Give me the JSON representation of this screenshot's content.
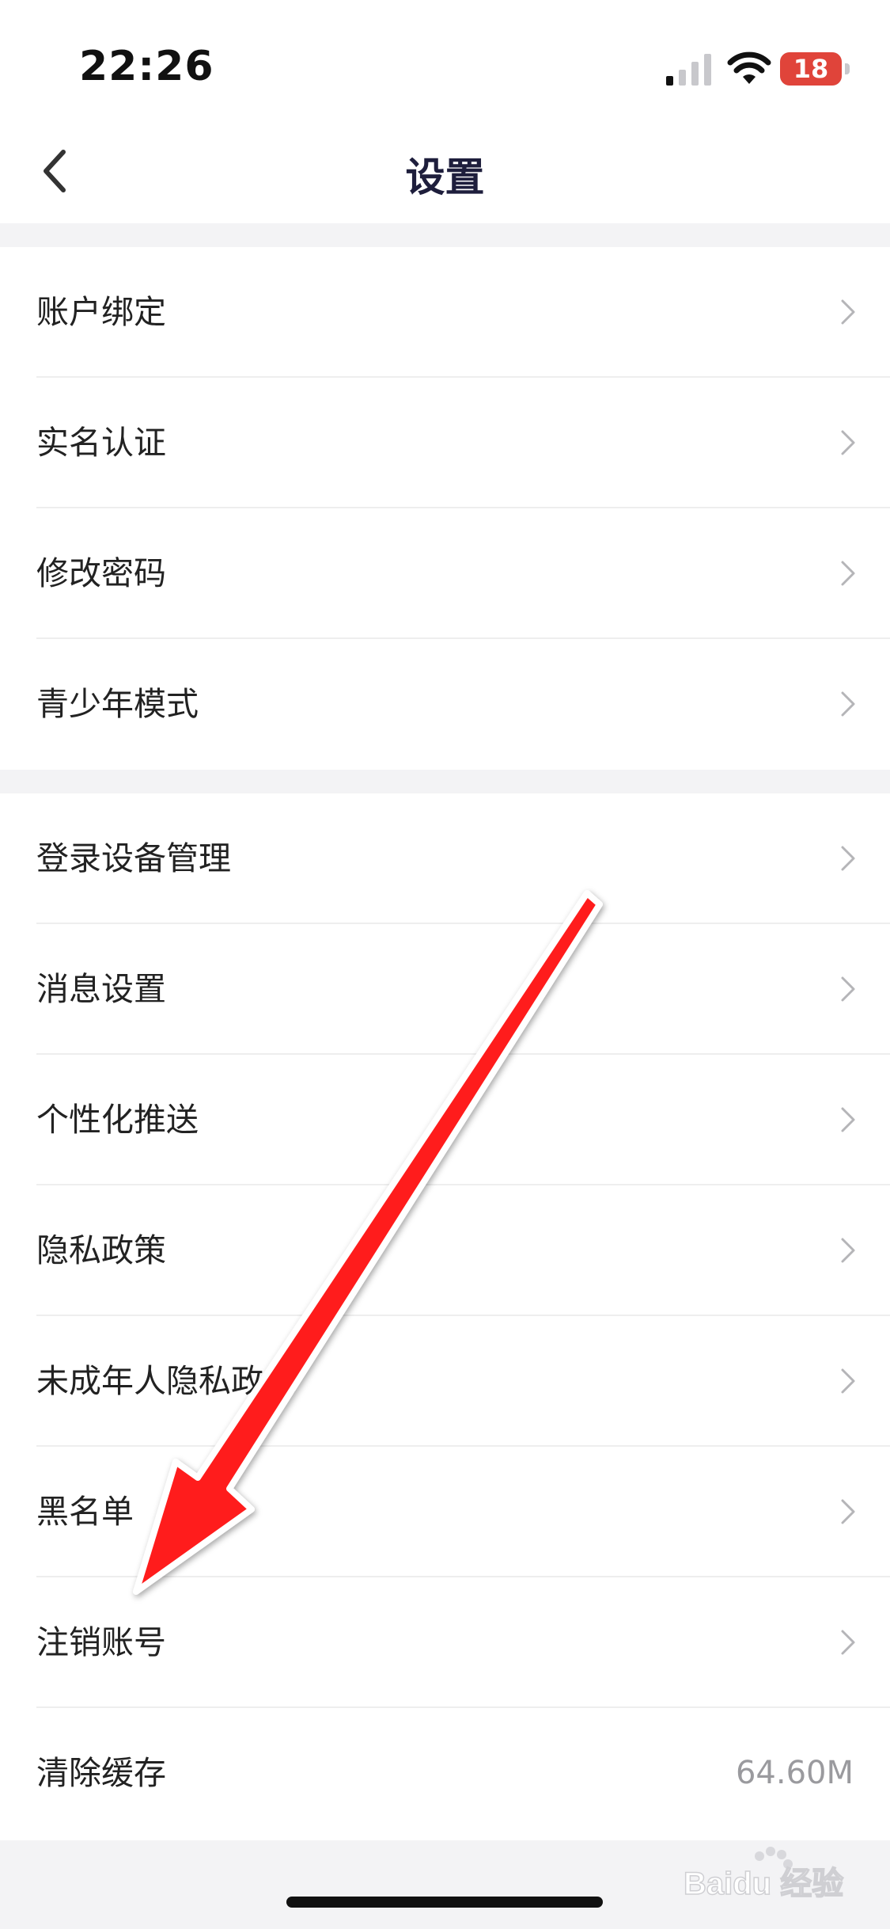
{
  "status_bar": {
    "time": "22:26",
    "battery_level": "18",
    "battery_fraction": 0.18,
    "battery_color": "#e0443a",
    "signal_icon": "cellular-signal-icon",
    "wifi_icon": "wifi-icon"
  },
  "nav": {
    "title": "设置",
    "back_icon": "chevron-left-icon"
  },
  "group1": {
    "items": [
      {
        "label": "账户绑定"
      },
      {
        "label": "实名认证"
      },
      {
        "label": "修改密码"
      },
      {
        "label": "青少年模式"
      }
    ]
  },
  "group2": {
    "items": [
      {
        "label": "登录设备管理"
      },
      {
        "label": "消息设置"
      },
      {
        "label": "个性化推送"
      },
      {
        "label": "隐私政策"
      },
      {
        "label": "未成年人隐私政策"
      },
      {
        "label": "黑名单"
      },
      {
        "label": "注销账号"
      },
      {
        "label": "清除缓存",
        "value": "64.60M"
      }
    ]
  },
  "annotation": {
    "arrow_color": "#ff1a1a"
  },
  "watermark": {
    "text": "Baidu 经验"
  }
}
